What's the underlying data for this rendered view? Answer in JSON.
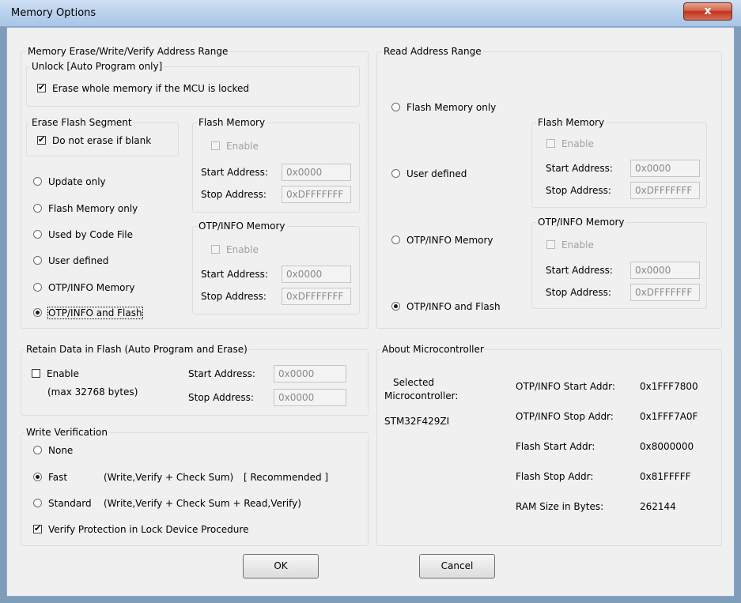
{
  "window": {
    "title": "Memory Options",
    "close_label": "x"
  },
  "erase_range": {
    "title": "Memory Erase/Write/Verify Address Range",
    "unlock": {
      "title": "Unlock [Auto Program only]",
      "checkbox": "Erase whole memory if the MCU is locked",
      "checked": true
    },
    "erase_segment": {
      "title": "Erase Flash Segment",
      "checkbox": "Do not erase if blank",
      "checked": true
    },
    "radios": [
      "Update only",
      "Flash Memory only",
      "Used by Code File",
      "User defined",
      "OTP/INFO Memory",
      "OTP/INFO and Flash"
    ],
    "selected": "OTP/INFO and Flash",
    "flash": {
      "title": "Flash Memory",
      "enable": "Enable",
      "start_label": "Start Address:",
      "start": "0x0000",
      "stop_label": "Stop Address:",
      "stop": "0xDFFFFFFF"
    },
    "otp": {
      "title": "OTP/INFO Memory",
      "enable": "Enable",
      "start_label": "Start Address:",
      "start": "0x0000",
      "stop_label": "Stop Address:",
      "stop": "0xDFFFFFFF"
    }
  },
  "read_range": {
    "title": "Read Address Range",
    "radios": [
      "Flash Memory only",
      "User defined",
      "OTP/INFO Memory",
      "OTP/INFO and Flash"
    ],
    "selected": "OTP/INFO and Flash",
    "flash": {
      "title": "Flash Memory",
      "enable": "Enable",
      "start_label": "Start Address:",
      "start": "0x0000",
      "stop_label": "Stop Address:",
      "stop": "0xDFFFFFFF"
    },
    "otp": {
      "title": "OTP/INFO Memory",
      "enable": "Enable",
      "start_label": "Start Address:",
      "start": "0x0000",
      "stop_label": "Stop Address:",
      "stop": "0xDFFFFFFF"
    }
  },
  "retain": {
    "title": "Retain Data in Flash  (Auto Program and Erase)",
    "enable": "Enable",
    "note": "(max 32768 bytes)",
    "start_label": "Start Address:",
    "start": "0x0000",
    "stop_label": "Stop Address:",
    "stop": "0x0000"
  },
  "verify": {
    "title": "Write Verification",
    "none": "None",
    "fast": "Fast",
    "fast_desc": "(Write,Verify + Check Sum)",
    "fast_note": "[ Recommended ]",
    "standard": "Standard",
    "standard_desc": "(Write,Verify + Check Sum + Read,Verify)",
    "selected": "Fast",
    "protection": "Verify Protection in Lock Device Procedure",
    "protection_checked": true
  },
  "about": {
    "title": "About Microcontroller",
    "selected_label_1": "Selected",
    "selected_label_2": "Microcontroller:",
    "mcu": "STM32F429ZI",
    "rows": [
      {
        "label": "OTP/INFO Start Addr:",
        "value": "0x1FFF7800"
      },
      {
        "label": "OTP/INFO Stop Addr:",
        "value": "0x1FFF7A0F"
      },
      {
        "label": "Flash Start Addr:",
        "value": "0x8000000"
      },
      {
        "label": "Flash Stop Addr:",
        "value": "0x81FFFFF"
      },
      {
        "label": "RAM Size in Bytes:",
        "value": "262144"
      }
    ]
  },
  "buttons": {
    "ok": "OK",
    "cancel": "Cancel"
  }
}
